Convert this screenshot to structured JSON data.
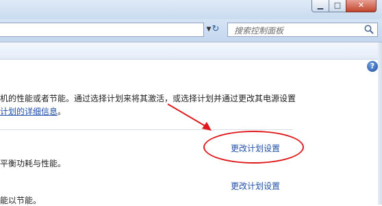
{
  "window": {
    "min_symbol": "▁",
    "max_symbol": "□",
    "close_symbol": "✕"
  },
  "address_bar": {
    "dropdown_symbol": "▼",
    "refresh_symbol": "↻"
  },
  "search": {
    "placeholder": "搜索控制面板"
  },
  "help": {
    "symbol": "?"
  },
  "content": {
    "intro_line1": "机的性能或者节能。通过选择计划来将其激活，或选择计划并通过更改其电源设置",
    "intro_link": "计划的详细信息",
    "intro_link_suffix": "。",
    "plan1_desc": "平衡功耗与性能。",
    "plan1_link": "更改计划设置",
    "plan2_link": "更改计划设置",
    "plan3_desc": "能以节能。"
  },
  "annotation": {
    "oval_color": "#e0181c",
    "arrow_color": "#e0181c"
  }
}
